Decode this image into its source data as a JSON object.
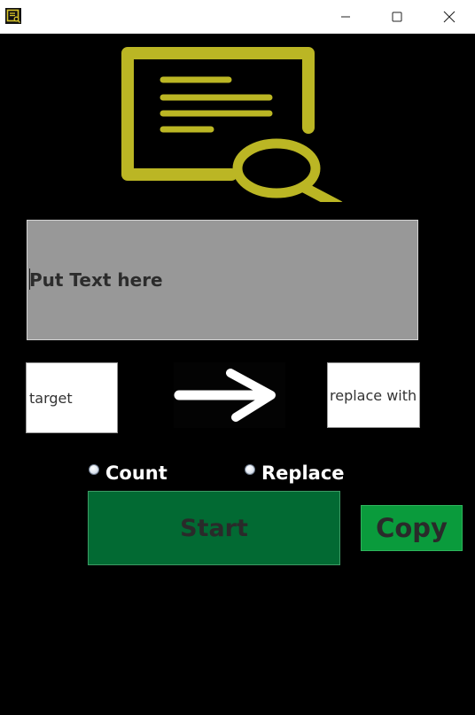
{
  "window": {
    "app_icon": "text-search-icon",
    "controls": [
      "minimize-icon",
      "maximize-icon",
      "close-icon"
    ]
  },
  "logo": {
    "icon": "document-search-icon",
    "color": "#bbb624"
  },
  "text_area": {
    "placeholder": "Put Text here"
  },
  "target_field": {
    "value": "target"
  },
  "arrow": {
    "icon": "arrow-right-icon"
  },
  "replace_field": {
    "value": "replace with"
  },
  "options": {
    "count_label": "Count",
    "replace_label": "Replace",
    "count_selected": false,
    "replace_selected": false
  },
  "buttons": {
    "start_label": "Start",
    "copy_label": "Copy",
    "start_color": "#026a33",
    "copy_color": "#0a9b3c"
  }
}
